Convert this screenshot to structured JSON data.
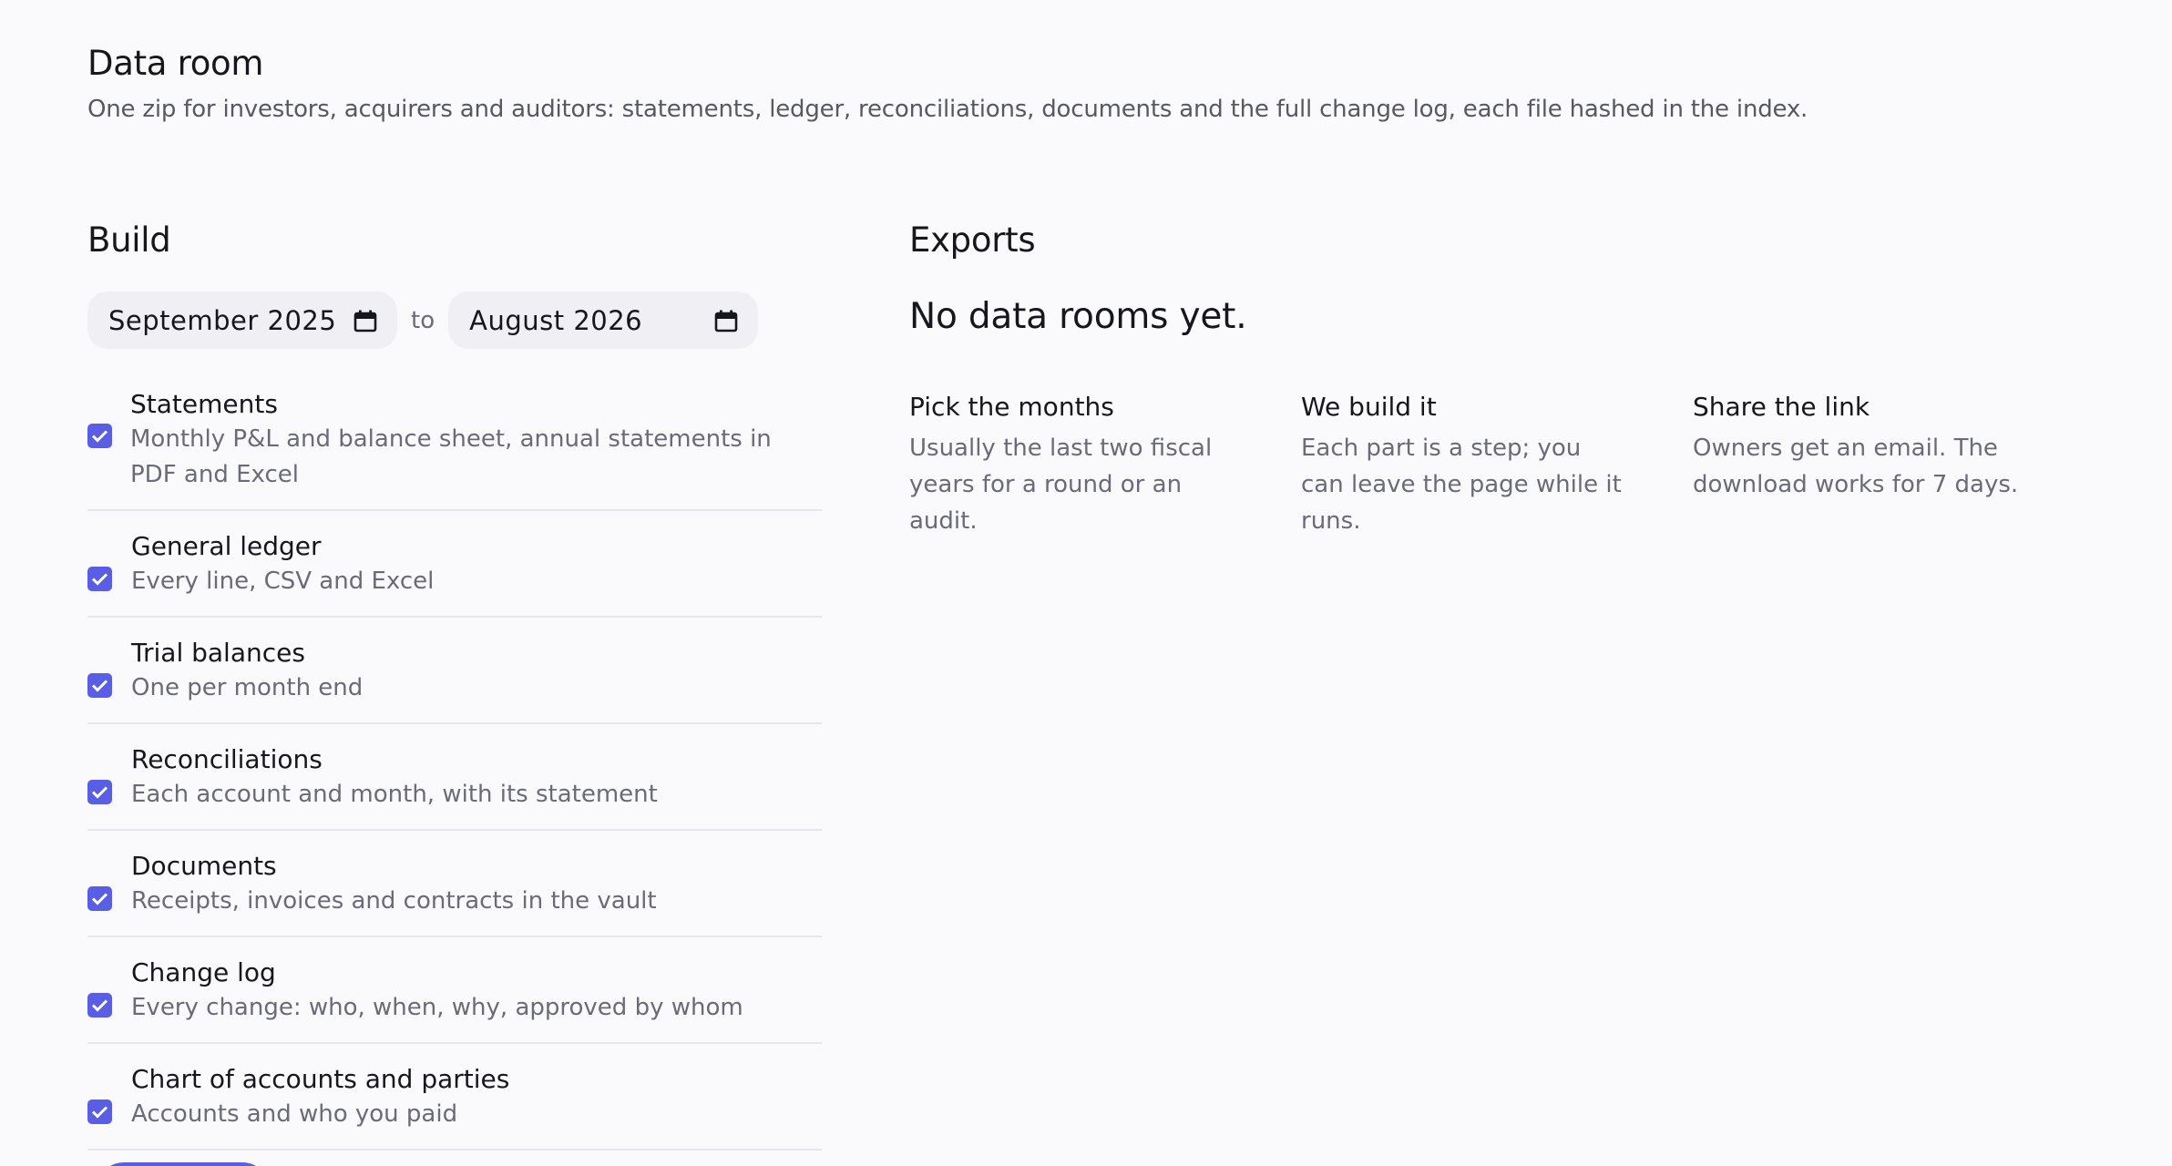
{
  "header": {
    "title": "Data room",
    "subtitle": "One zip for investors, acquirers and auditors: statements, ledger, reconciliations, documents and the full change log, each file hashed in the index."
  },
  "build": {
    "title": "Build",
    "from_month": "September 2025",
    "to_label": "to",
    "to_month": "August 2026",
    "icon": "calendar-icon",
    "options": [
      {
        "label": "Statements",
        "desc": "Monthly P&L and balance sheet, annual statements in PDF and Excel",
        "checked": true
      },
      {
        "label": "General ledger",
        "desc": "Every line, CSV and Excel",
        "checked": true
      },
      {
        "label": "Trial balances",
        "desc": "One per month end",
        "checked": true
      },
      {
        "label": "Reconciliations",
        "desc": "Each account and month, with its statement",
        "checked": true
      },
      {
        "label": "Documents",
        "desc": "Receipts, invoices and contracts in the vault",
        "checked": true
      },
      {
        "label": "Change log",
        "desc": "Every change: who, when, why, approved by whom",
        "checked": true
      },
      {
        "label": "Chart of accounts and parties",
        "desc": "Accounts and who you paid",
        "checked": true
      }
    ]
  },
  "exports": {
    "title": "Exports",
    "empty_title": "No data rooms yet.",
    "steps": [
      {
        "title": "Pick the months",
        "desc": "Usually the last two fiscal years for a round or an audit."
      },
      {
        "title": "We build it",
        "desc": "Each part is a step; you can leave the page while it runs."
      },
      {
        "title": "Share the link",
        "desc": "Owners get an email. The download works for 7 days."
      }
    ]
  },
  "colors": {
    "accent": "#5a5ee4",
    "background": "#fafafd",
    "muted_text": "#6b6b77"
  }
}
